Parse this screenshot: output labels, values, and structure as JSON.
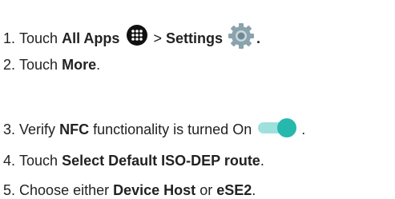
{
  "steps": [
    {
      "number": "1.",
      "parts": [
        "Touch",
        "All Apps",
        ">",
        "Settings",
        "."
      ]
    },
    {
      "number": "2.",
      "parts": [
        "Touch",
        "More",
        "."
      ]
    },
    {
      "number": "3.",
      "parts": [
        "Verify",
        "NFC",
        "functionality is turned On",
        "."
      ]
    },
    {
      "number": "4.",
      "parts": [
        "Touch",
        "Select Default ISO-DEP route",
        "."
      ]
    },
    {
      "number": "5.",
      "parts": [
        "Choose either",
        "Device Host",
        "or",
        "eSE2",
        "."
      ]
    }
  ],
  "icons": {
    "all_apps": "all-apps-icon",
    "settings": "settings-gear-icon",
    "toggle": "toggle-on-icon"
  },
  "colors": {
    "toggle_track": "#9ee0dc",
    "toggle_knob": "#27b8ad",
    "gear": "#8aa3ad",
    "text": "#222222"
  }
}
